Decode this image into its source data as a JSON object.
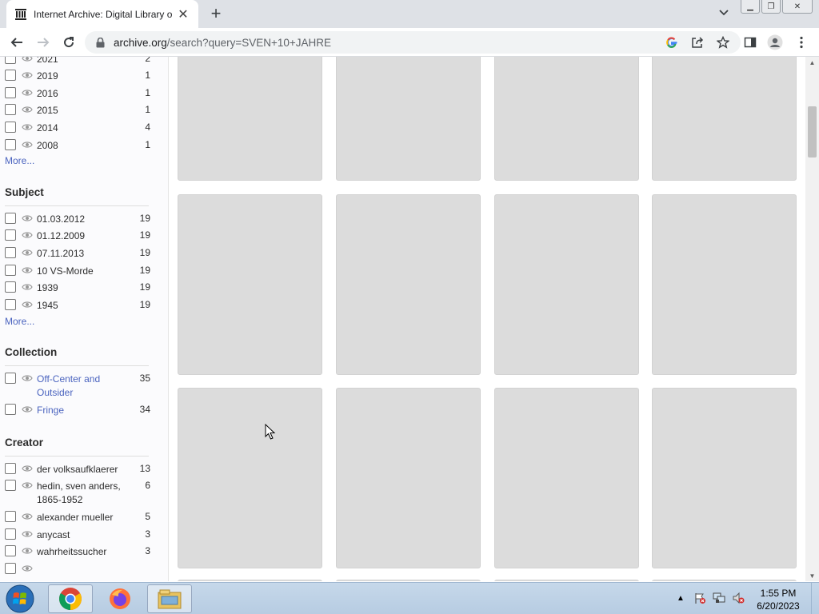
{
  "browser": {
    "tab_title": "Internet Archive: Digital Library o",
    "tab_favicon": "internet-archive-icon",
    "url_host": "archive.org",
    "url_path": "/search?query=SVEN+10+JAHRE",
    "window_buttons": [
      "minimize",
      "restore",
      "close"
    ]
  },
  "sidebar": {
    "year_items": [
      {
        "label": "2021",
        "count": "2"
      },
      {
        "label": "2019",
        "count": "1"
      },
      {
        "label": "2016",
        "count": "1"
      },
      {
        "label": "2015",
        "count": "1"
      },
      {
        "label": "2014",
        "count": "4"
      },
      {
        "label": "2008",
        "count": "1"
      }
    ],
    "year_more": "More...",
    "subject_heading": "Subject",
    "subject_items": [
      {
        "label": "01.03.2012",
        "count": "19"
      },
      {
        "label": "01.12.2009",
        "count": "19"
      },
      {
        "label": "07.11.2013",
        "count": "19"
      },
      {
        "label": "10 VS-Morde",
        "count": "19"
      },
      {
        "label": "1939",
        "count": "19"
      },
      {
        "label": "1945",
        "count": "19"
      }
    ],
    "subject_more": "More...",
    "collection_heading": "Collection",
    "collection_items": [
      {
        "label_line1": "Off-Center and",
        "label_line2": "Outsider",
        "count": "35"
      },
      {
        "label": "Fringe",
        "count": "34"
      }
    ],
    "creator_heading": "Creator",
    "creator_items": [
      {
        "label": "der volksaufklaerer",
        "count": "13"
      },
      {
        "label_line1": "hedin, sven anders,",
        "label_line2": "1865-1952",
        "count": "6"
      },
      {
        "label": "alexander mueller",
        "count": "5"
      },
      {
        "label": "anycast",
        "count": "3"
      },
      {
        "label": "wahrheitssucher",
        "count": "3"
      }
    ]
  },
  "taskbar": {
    "apps": [
      "chrome-icon",
      "firefox-icon",
      "file-explorer-icon"
    ],
    "time": "1:55 PM",
    "date": "6/20/2023"
  },
  "colors": {
    "link": "#4b64bf",
    "placeholder_card": "#dcdcdc",
    "tabstrip": "#dee1e6"
  }
}
